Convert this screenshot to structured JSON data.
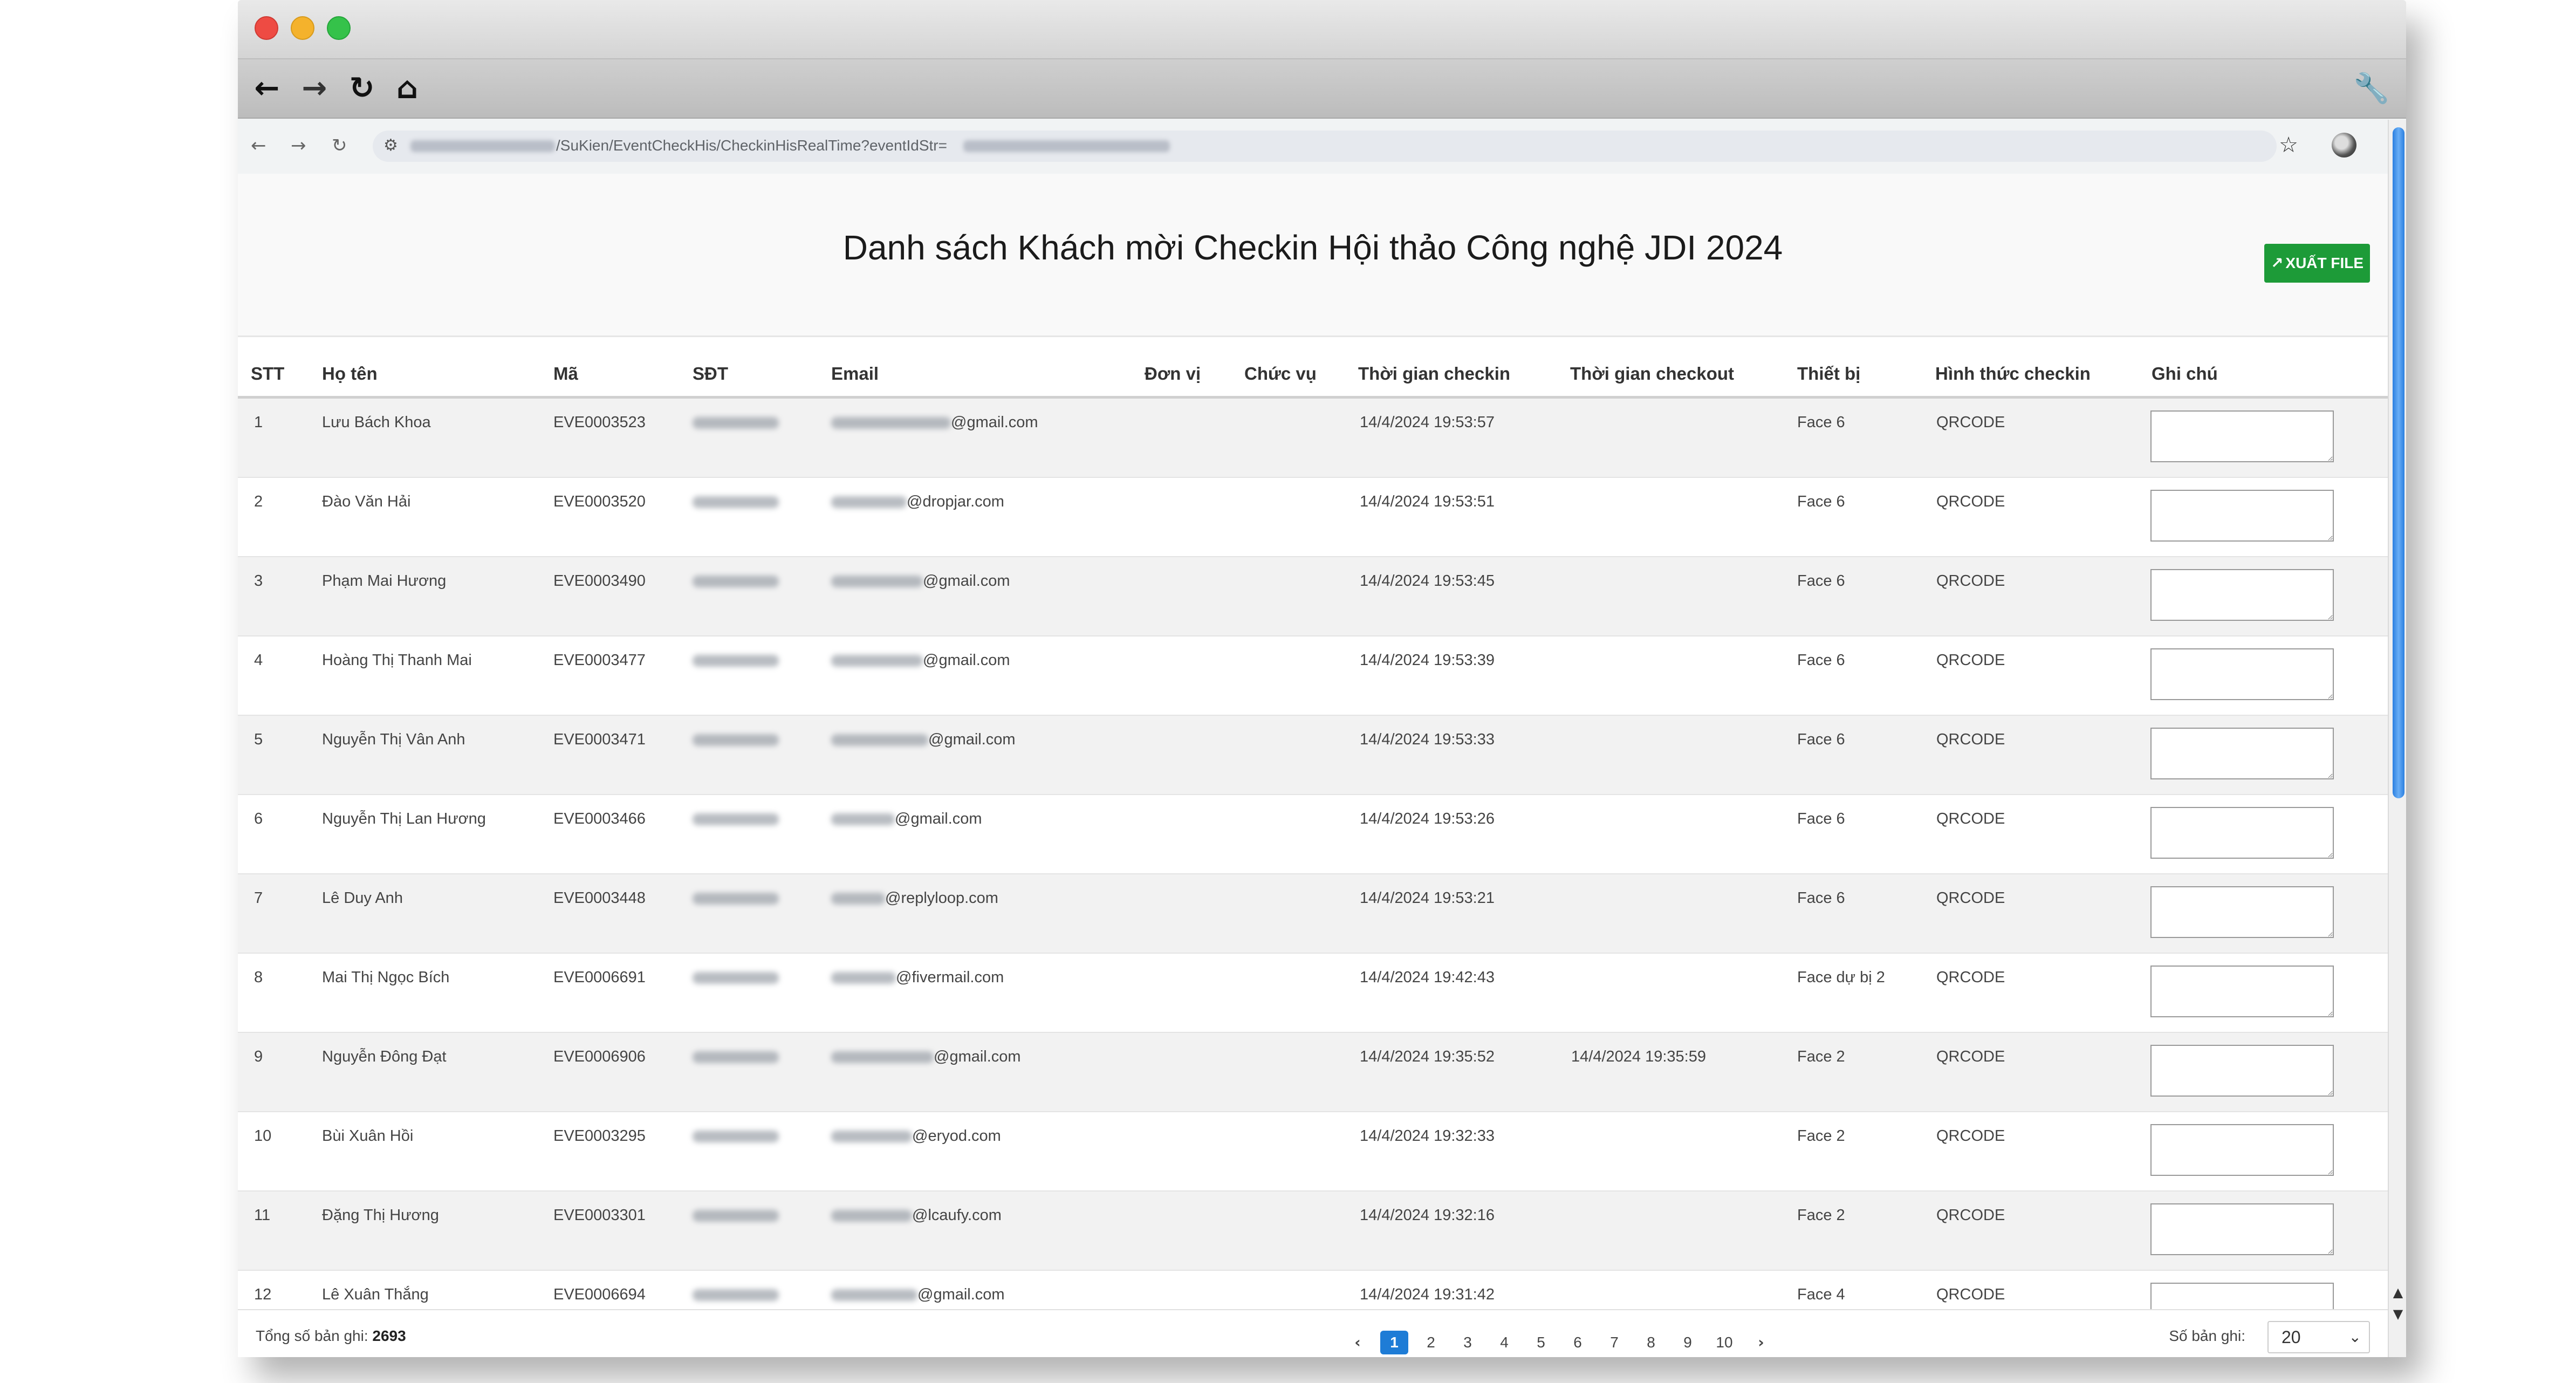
{
  "browser": {
    "url_visible": "/SuKien/EventCheckHis/CheckinHisRealTime?eventIdStr=",
    "icons": [
      "back-arrow-icon",
      "forward-arrow-icon",
      "reload-icon",
      "home-icon",
      "wrench-icon",
      "star-icon",
      "profile-icon"
    ]
  },
  "page": {
    "title": "Danh sách Khách mời Checkin Hội thảo Công nghệ JDI 2024",
    "export_label": "XUẤT FILE"
  },
  "table": {
    "headers": {
      "stt": "STT",
      "name": "Họ tên",
      "code": "Mã",
      "phone": "SĐT",
      "email": "Email",
      "unit": "Đơn vị",
      "position": "Chức vụ",
      "checkin": "Thời gian checkin",
      "checkout": "Thời gian checkout",
      "device": "Thiết bị",
      "method": "Hình thức checkin",
      "note": "Ghi chú"
    },
    "rows": [
      {
        "stt": "1",
        "name": "Lưu Bách Khoa",
        "code": "EVE0003523",
        "email_suffix": "@gmail.com",
        "checkin": "14/4/2024 19:53:57",
        "checkout": "",
        "device": "Face 6",
        "method": "QRCODE"
      },
      {
        "stt": "2",
        "name": "Đào Văn Hải",
        "code": "EVE0003520",
        "email_suffix": "@dropjar.com",
        "checkin": "14/4/2024 19:53:51",
        "checkout": "",
        "device": "Face 6",
        "method": "QRCODE"
      },
      {
        "stt": "3",
        "name": "Phạm Mai Hương",
        "code": "EVE0003490",
        "email_suffix": "@gmail.com",
        "checkin": "14/4/2024 19:53:45",
        "checkout": "",
        "device": "Face 6",
        "method": "QRCODE"
      },
      {
        "stt": "4",
        "name": "Hoàng Thị Thanh Mai",
        "code": "EVE0003477",
        "email_suffix": "@gmail.com",
        "checkin": "14/4/2024 19:53:39",
        "checkout": "",
        "device": "Face 6",
        "method": "QRCODE"
      },
      {
        "stt": "5",
        "name": "Nguyễn Thị Vân Anh",
        "code": "EVE0003471",
        "email_suffix": "@gmail.com",
        "checkin": "14/4/2024 19:53:33",
        "checkout": "",
        "device": "Face 6",
        "method": "QRCODE"
      },
      {
        "stt": "6",
        "name": "Nguyễn Thị Lan Hương",
        "code": "EVE0003466",
        "email_suffix": "@gmail.com",
        "checkin": "14/4/2024 19:53:26",
        "checkout": "",
        "device": "Face 6",
        "method": "QRCODE"
      },
      {
        "stt": "7",
        "name": "Lê Duy Anh",
        "code": "EVE0003448",
        "email_suffix": "@replyloop.com",
        "checkin": "14/4/2024 19:53:21",
        "checkout": "",
        "device": "Face 6",
        "method": "QRCODE"
      },
      {
        "stt": "8",
        "name": "Mai Thị Ngọc Bích",
        "code": "EVE0006691",
        "email_suffix": "@fivermail.com",
        "checkin": "14/4/2024 19:42:43",
        "checkout": "",
        "device": "Face dự bị 2",
        "method": "QRCODE"
      },
      {
        "stt": "9",
        "name": "Nguyễn Đông Đạt",
        "code": "EVE0006906",
        "email_suffix": "@gmail.com",
        "checkin": "14/4/2024 19:35:52",
        "checkout": "14/4/2024 19:35:59",
        "device": "Face 2",
        "method": "QRCODE"
      },
      {
        "stt": "10",
        "name": "Bùi Xuân Hồi",
        "code": "EVE0003295",
        "email_suffix": "@eryod.com",
        "checkin": "14/4/2024 19:32:33",
        "checkout": "",
        "device": "Face 2",
        "method": "QRCODE"
      },
      {
        "stt": "11",
        "name": "Đặng Thị Hương",
        "code": "EVE0003301",
        "email_suffix": "@lcaufy.com",
        "checkin": "14/4/2024 19:32:16",
        "checkout": "",
        "device": "Face 2",
        "method": "QRCODE"
      },
      {
        "stt": "12",
        "name": "Lê Xuân Thắng",
        "code": "EVE0006694",
        "email_suffix": "@gmail.com",
        "checkin": "14/4/2024 19:31:42",
        "checkout": "",
        "device": "Face 4",
        "method": "QRCODE"
      }
    ]
  },
  "footer": {
    "total_label": "Tổng số bản ghi:",
    "total_value": "2693",
    "pages": [
      "1",
      "2",
      "3",
      "4",
      "5",
      "6",
      "7",
      "8",
      "9",
      "10"
    ],
    "current_page": "1",
    "per_page_label": "Số bản ghi:",
    "per_page_value": "20"
  }
}
